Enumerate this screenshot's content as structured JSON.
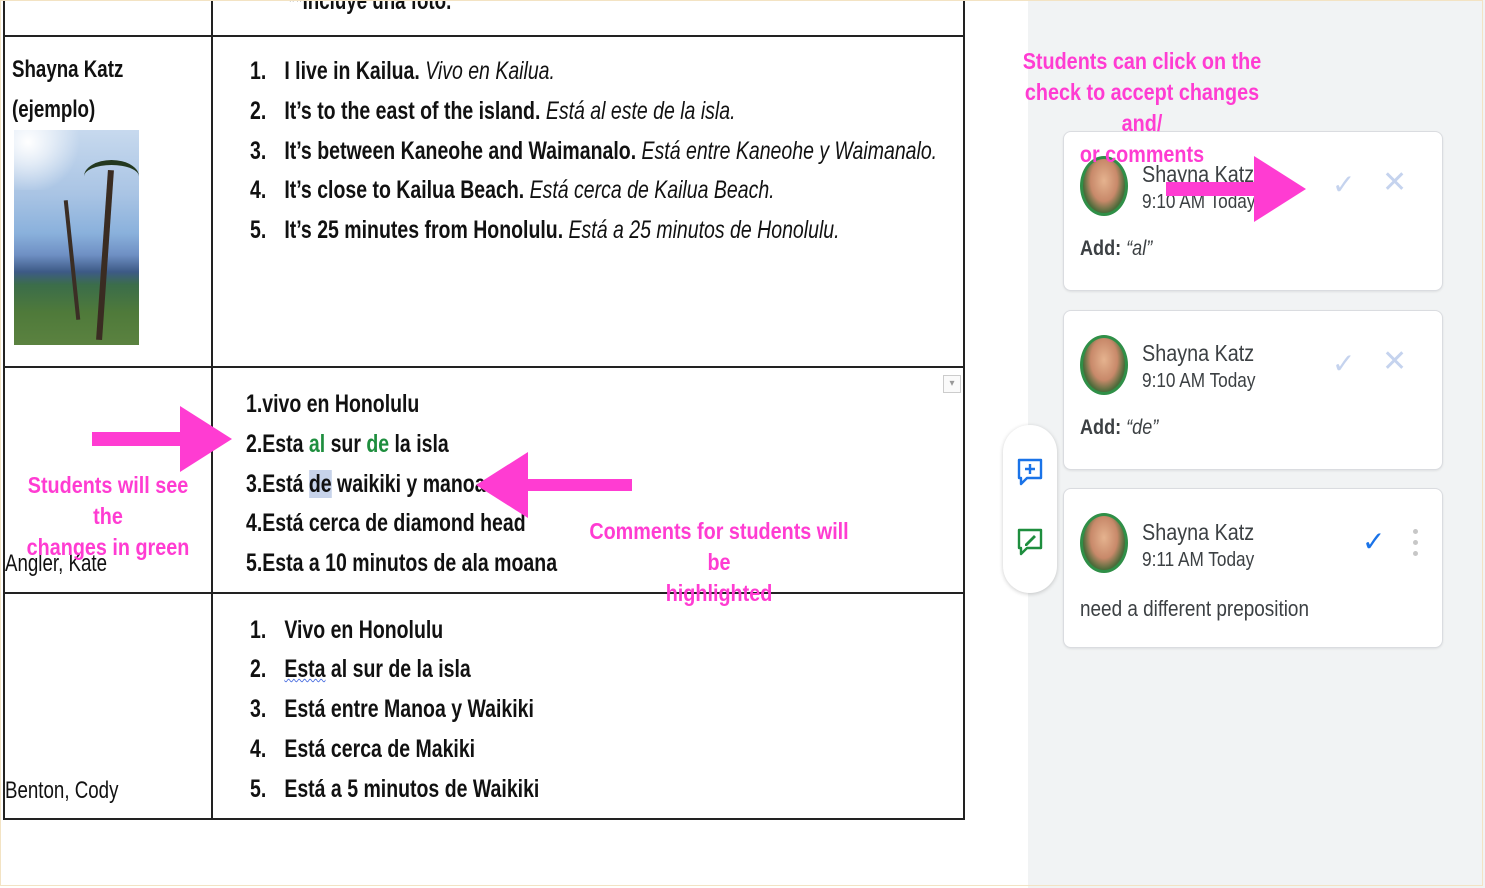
{
  "document": {
    "header_fragment": "**Incluye una foto.",
    "rows": [
      {
        "name_line1": "Shayna Katz",
        "name_line2": "(ejemplo)",
        "photo_icon": "beach-palm-photo",
        "items": [
          {
            "num": "1.",
            "en": "I live in Kailua.",
            "es": "Vivo en Kailua."
          },
          {
            "num": "2.",
            "en": "It’s to the east of the island.",
            "es": "Está al este de la isla."
          },
          {
            "num": "3.",
            "en": "It’s between Kaneohe and Waimanalo.",
            "es": "Está entre Kaneohe y Waimanalo."
          },
          {
            "num": "4.",
            "en": "It’s close to Kailua Beach.",
            "es": "Está cerca de Kailua Beach."
          },
          {
            "num": "5.",
            "en": "It’s 25 minutes from Honolulu.",
            "es": "Está a 25 minutos de Honolulu."
          }
        ]
      },
      {
        "name": "Angler, Kate",
        "items": [
          {
            "text": "1.vivo en Honolulu"
          },
          {
            "pre": "2.Esta ",
            "add1": "al",
            "mid": " sur ",
            "add2": "de",
            "post": " la isla"
          },
          {
            "pre": "3.Está ",
            "hl": "de",
            "post": " waikiki y manoa"
          },
          {
            "text": "4.Está cerca de diamond head"
          },
          {
            "text": "5.Esta a 10 minutos de ala moana"
          }
        ]
      },
      {
        "name": "Benton, Cody",
        "items": [
          {
            "num": "1.",
            "text": "Vivo en Honolulu"
          },
          {
            "num": "2.",
            "text_a": "Esta",
            "text_b": " al sur de la isla"
          },
          {
            "num": "3.",
            "text": "Está entre Manoa y Waikiki"
          },
          {
            "num": "4.",
            "text": "Está cerca de Makiki"
          },
          {
            "num": "5.",
            "text": "Está a 5 minutos de Waikiki"
          }
        ]
      }
    ]
  },
  "annotations": {
    "top_line1": "Students can click on the",
    "top_line2": "check to accept changes and/",
    "top_line3": "or comments",
    "left_line1": "Students will see the",
    "left_line2": "changes in green",
    "middle_line1": "Comments for students will be",
    "middle_line2": "highlighted",
    "color": "#ff3cd2"
  },
  "toolbar": {
    "add_comment_icon": "add-comment-icon",
    "suggest_edit_icon": "suggest-edit-icon"
  },
  "comments": [
    {
      "author": "Shayna Katz",
      "time": "9:10 AM Today",
      "action_label": "Add:",
      "action_value": "“al”",
      "status": "suggestion"
    },
    {
      "author": "Shayna Katz",
      "time": "9:10 AM Today",
      "action_label": "Add:",
      "action_value": "“de”",
      "status": "suggestion"
    },
    {
      "author": "Shayna Katz",
      "time": "9:11 AM Today",
      "body": "need a different preposition",
      "status": "comment"
    }
  ],
  "colors": {
    "accent_blue": "#1a73e8",
    "suggestion_green": "#1e8e3e",
    "sidebar_bg": "#f1f3f4"
  }
}
